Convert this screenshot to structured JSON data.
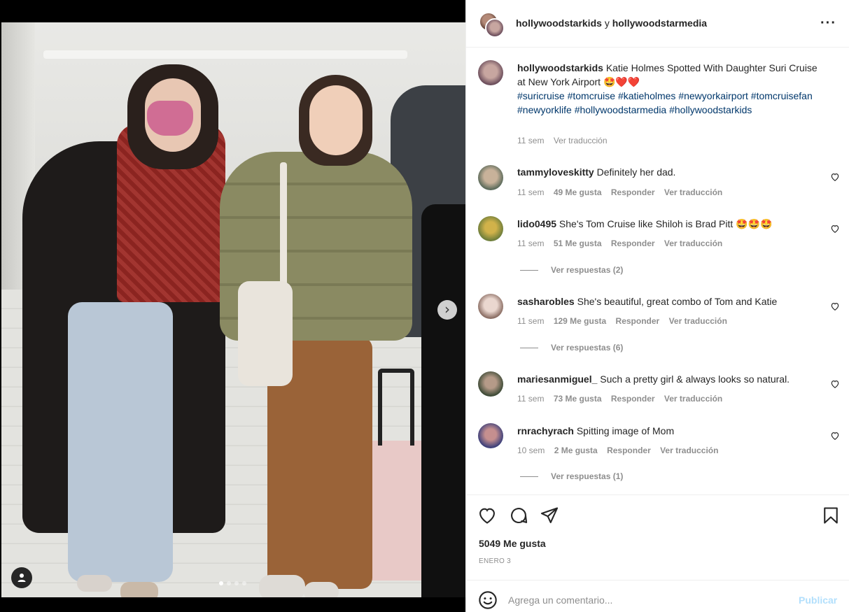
{
  "post": {
    "authors": {
      "first": "hollywoodstarkids",
      "connector": "y",
      "second": "hollywoodstarmedia"
    },
    "caption": {
      "username": "hollywoodstarkids",
      "text": "Katie Holmes Spotted With Daughter Suri Cruise at New York Airport 🤩❤️❤️",
      "hashtags": "#suricruise #tomcruise #katieholmes #newyorkairport #tomcruisefan #newyorklife #hollywoodstarmedia #hollywoodstarkids",
      "time": "11 sem",
      "translate": "Ver traducción"
    },
    "carousel": {
      "slide_count": 4,
      "active_slide": 1
    },
    "likes_text": "5049 Me gusta",
    "date": "ENERO 3"
  },
  "comments": [
    {
      "username": "tammyloveskitty",
      "text": "Definitely her dad.",
      "time": "11 sem",
      "likes": "49 Me gusta",
      "reply": "Responder",
      "translate": "Ver traducción",
      "replies": ""
    },
    {
      "username": "lido0495",
      "text": "She's Tom Cruise like Shiloh is Brad Pitt 🤩🤩🤩",
      "time": "11 sem",
      "likes": "51 Me gusta",
      "reply": "Responder",
      "translate": "Ver traducción",
      "replies": "Ver respuestas (2)"
    },
    {
      "username": "sasharobles",
      "text": "She's beautiful, great combo of Tom and Katie",
      "time": "11 sem",
      "likes": "129 Me gusta",
      "reply": "Responder",
      "translate": "Ver traducción",
      "replies": "Ver respuestas (6)"
    },
    {
      "username": "mariesanmiguel_",
      "text": "Such a pretty girl & always looks so natural.",
      "time": "11 sem",
      "likes": "73 Me gusta",
      "reply": "Responder",
      "translate": "Ver traducción",
      "replies": ""
    },
    {
      "username": "rnrachyrach",
      "text": "Spitting image of Mom",
      "time": "10 sem",
      "likes": "2 Me gusta",
      "reply": "Responder",
      "translate": "Ver traducción",
      "replies": "Ver respuestas (1)"
    }
  ],
  "compose": {
    "placeholder": "Agrega un comentario...",
    "publish": "Publicar"
  },
  "icons": {
    "more": "more-horizontal-icon",
    "like": "heart-icon",
    "comment": "comment-bubble-icon",
    "share": "paper-plane-icon",
    "save": "bookmark-icon",
    "emoji": "smiley-icon",
    "next": "chevron-right-icon",
    "tag": "user-tag-icon"
  },
  "colors": {
    "link": "#00376b",
    "muted": "#8e8e8e",
    "publish_disabled": "#b2dffc",
    "text": "#262626"
  }
}
